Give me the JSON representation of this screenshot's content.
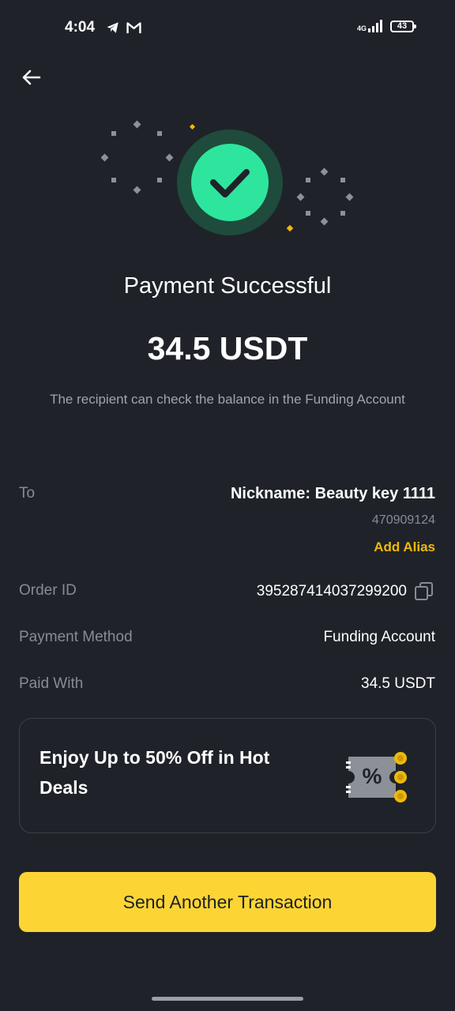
{
  "status_bar": {
    "time": "4:04",
    "network": "4G",
    "battery": "43",
    "icons": [
      "telegram-icon",
      "gmail-icon",
      "signal-icon",
      "battery-icon"
    ]
  },
  "header": {
    "back_icon": "arrow-left-icon"
  },
  "result": {
    "icon": "check-circle-icon",
    "title": "Payment Successful",
    "amount": "34.5 USDT",
    "note": "The recipient can check the balance in the Funding Account"
  },
  "details": {
    "to_label": "To",
    "to_name": "Nickname: Beauty key 1111",
    "to_id": "470909124",
    "add_alias": "Add Alias",
    "order_label": "Order ID",
    "order_id": "395287414037299200",
    "payment_method_label": "Payment Method",
    "payment_method": "Funding Account",
    "paid_with_label": "Paid With",
    "paid_with": "34.5 USDT"
  },
  "promo": {
    "text": "Enjoy Up to 50% Off in Hot Deals",
    "icon": "coupon-icon"
  },
  "actions": {
    "send_another": "Send Another Transaction"
  },
  "colors": {
    "background": "#1f2329",
    "accent": "#fcd535",
    "success": "#2ee59d",
    "muted_text": "#868c95"
  }
}
